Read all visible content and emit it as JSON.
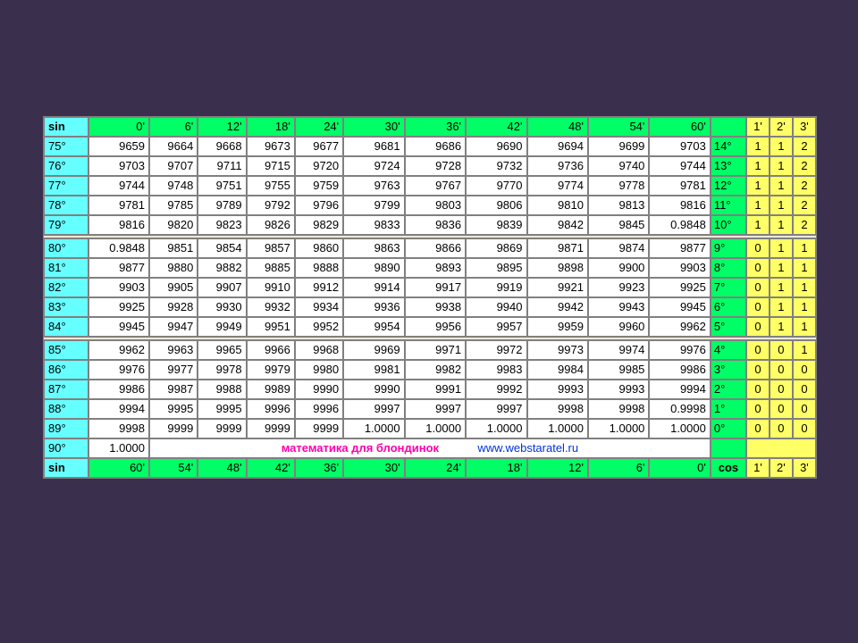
{
  "top": {
    "label": "sin",
    "mins": [
      "0'",
      "6'",
      "12'",
      "18'",
      "24'",
      "30'",
      "36'",
      "42'",
      "48'",
      "54'",
      "60'"
    ],
    "corr": [
      "1'",
      "2'",
      "3'"
    ]
  },
  "rows": [
    {
      "deg": "75°",
      "v": [
        "9659",
        "9664",
        "9668",
        "9673",
        "9677",
        "9681",
        "9686",
        "9690",
        "9694",
        "9699",
        "9703"
      ],
      "comp": "14°",
      "c": [
        "1",
        "1",
        "2"
      ]
    },
    {
      "deg": "76°",
      "v": [
        "9703",
        "9707",
        "9711",
        "9715",
        "9720",
        "9724",
        "9728",
        "9732",
        "9736",
        "9740",
        "9744"
      ],
      "comp": "13°",
      "c": [
        "1",
        "1",
        "2"
      ]
    },
    {
      "deg": "77°",
      "v": [
        "9744",
        "9748",
        "9751",
        "9755",
        "9759",
        "9763",
        "9767",
        "9770",
        "9774",
        "9778",
        "9781"
      ],
      "comp": "12°",
      "c": [
        "1",
        "1",
        "2"
      ]
    },
    {
      "deg": "78°",
      "v": [
        "9781",
        "9785",
        "9789",
        "9792",
        "9796",
        "9799",
        "9803",
        "9806",
        "9810",
        "9813",
        "9816"
      ],
      "comp": "11°",
      "c": [
        "1",
        "1",
        "2"
      ]
    },
    {
      "deg": "79°",
      "v": [
        "9816",
        "9820",
        "9823",
        "9826",
        "9829",
        "9833",
        "9836",
        "9839",
        "9842",
        "9845",
        "0.9848"
      ],
      "comp": "10°",
      "c": [
        "1",
        "1",
        "2"
      ]
    }
  ],
  "rows2": [
    {
      "deg": "80°",
      "v": [
        "0.9848",
        "9851",
        "9854",
        "9857",
        "9860",
        "9863",
        "9866",
        "9869",
        "9871",
        "9874",
        "9877"
      ],
      "comp": "9°",
      "c": [
        "0",
        "1",
        "1"
      ]
    },
    {
      "deg": "81°",
      "v": [
        "9877",
        "9880",
        "9882",
        "9885",
        "9888",
        "9890",
        "9893",
        "9895",
        "9898",
        "9900",
        "9903"
      ],
      "comp": "8°",
      "c": [
        "0",
        "1",
        "1"
      ]
    },
    {
      "deg": "82°",
      "v": [
        "9903",
        "9905",
        "9907",
        "9910",
        "9912",
        "9914",
        "9917",
        "9919",
        "9921",
        "9923",
        "9925"
      ],
      "comp": "7°",
      "c": [
        "0",
        "1",
        "1"
      ]
    },
    {
      "deg": "83°",
      "v": [
        "9925",
        "9928",
        "9930",
        "9932",
        "9934",
        "9936",
        "9938",
        "9940",
        "9942",
        "9943",
        "9945"
      ],
      "comp": "6°",
      "c": [
        "0",
        "1",
        "1"
      ]
    },
    {
      "deg": "84°",
      "v": [
        "9945",
        "9947",
        "9949",
        "9951",
        "9952",
        "9954",
        "9956",
        "9957",
        "9959",
        "9960",
        "9962"
      ],
      "comp": "5°",
      "c": [
        "0",
        "1",
        "1"
      ]
    }
  ],
  "rows3": [
    {
      "deg": "85°",
      "v": [
        "9962",
        "9963",
        "9965",
        "9966",
        "9968",
        "9969",
        "9971",
        "9972",
        "9973",
        "9974",
        "9976"
      ],
      "comp": "4°",
      "c": [
        "0",
        "0",
        "1"
      ]
    },
    {
      "deg": "86°",
      "v": [
        "9976",
        "9977",
        "9978",
        "9979",
        "9980",
        "9981",
        "9982",
        "9983",
        "9984",
        "9985",
        "9986"
      ],
      "comp": "3°",
      "c": [
        "0",
        "0",
        "0"
      ]
    },
    {
      "deg": "87°",
      "v": [
        "9986",
        "9987",
        "9988",
        "9989",
        "9990",
        "9990",
        "9991",
        "9992",
        "9993",
        "9993",
        "9994"
      ],
      "comp": "2°",
      "c": [
        "0",
        "0",
        "0"
      ]
    },
    {
      "deg": "88°",
      "v": [
        "9994",
        "9995",
        "9995",
        "9996",
        "9996",
        "9997",
        "9997",
        "9997",
        "9998",
        "9998",
        "0.9998"
      ],
      "comp": "1°",
      "c": [
        "0",
        "0",
        "0"
      ]
    },
    {
      "deg": "89°",
      "v": [
        "9998",
        "9999",
        "9999",
        "9999",
        "9999",
        "1.0000",
        "1.0000",
        "1.0000",
        "1.0000",
        "1.0000",
        "1.0000"
      ],
      "comp": "0°",
      "c": [
        "0",
        "0",
        "0"
      ]
    }
  ],
  "last": {
    "deg": "90°",
    "v": "1.0000",
    "note1": "математика для блондинок",
    "note2": "www.webstaratel.ru"
  },
  "bot": {
    "label": "sin",
    "mins": [
      "60'",
      "54'",
      "48'",
      "42'",
      "36'",
      "30'",
      "24'",
      "18'",
      "12'",
      "6'",
      "0'"
    ],
    "cos": "cos",
    "corr": [
      "1'",
      "2'",
      "3'"
    ]
  }
}
